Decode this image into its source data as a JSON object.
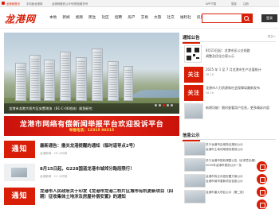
{
  "topbar": {
    "items": [
      "龙港网首页",
      "手机版龙港网",
      "龙港网微信公众号/微信服务号",
      "APP下载",
      "登录",
      "注册"
    ]
  },
  "header": {
    "logo_text": "龙港网",
    "logo_sub": "www.lg.cn",
    "nav": [
      "本地",
      "新闻",
      "视频",
      "民生",
      "社区",
      "招聘",
      "房产",
      "交易",
      "文旅",
      "社交",
      "福利社",
      "房屋号"
    ],
    "login_label": "登录"
  },
  "slider": {
    "caption": "龙港市龙港大桥片区安置地块（B1-C-06地块）规划研究",
    "dots": 5,
    "active_dot": 3
  },
  "banner": {
    "line1": "龙港市网络有偿新闻举报平台欢迎投诉平台",
    "line2": "举报电话：12315  96315"
  },
  "news": [
    {
      "tag": "通知",
      "title": "最新通告：撤关龙港提醒的通知（临时道导点2号）",
      "meta": "龙港新闻  · 16 小时前"
    },
    {
      "tag": "",
      "title": "8月15日起，G228国道龙港市城郊分路段限行！",
      "meta": "龙港新闻  · 11 小时前"
    },
    {
      "tag": "通知",
      "title": "龙港市人民政府关于印发《龙港市龙港二桥片区城市有机更新项目（四期）征收集体土地涉及房屋补偿安置》的通知",
      "meta": ""
    }
  ],
  "side": {
    "notice_head": "通知公告",
    "more": "更多>",
    "qr_lines": [
      "8月23日起：龙港市区公交线路",
      "调整及优化方案公示"
    ],
    "notices": [
      {
        "tag": "关注",
        "text": "2025 年 1 至 7 月龙港市生产总值统计",
        "date": "08-18"
      },
      {
        "tag": "关注",
        "text": "龙港市人力资源和社会保障局最新发布",
        "date": "08-16"
      }
    ],
    "tip": "新增功能！随时查看用户信息，更多精彩内容",
    "info_head": "信息公示",
    "info_list": [
      "关于龙港市区域特征规划公示",
      "龙港市土地利用规划批前公示",
      "关于龙港市规划调整公告（征求意见稿）",
      "2025年龙港市规划公示一览",
      "龙港市拆迁补偿安置方案公示",
      "龙港市城市更新项目信息公示",
      "龙港市重大项目公示（第二批）"
    ]
  }
}
